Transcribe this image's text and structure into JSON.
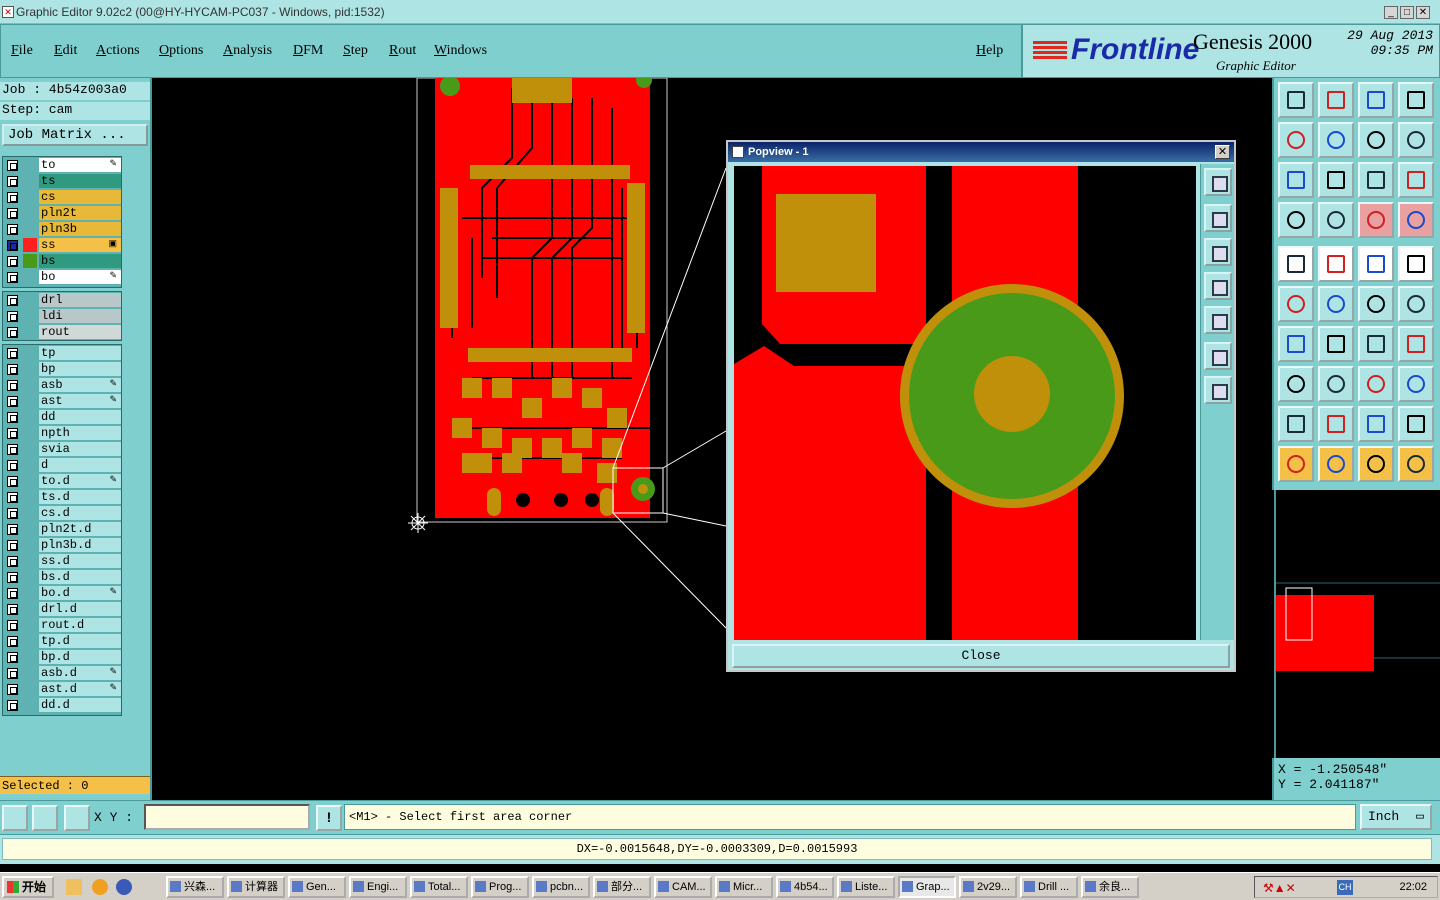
{
  "window": {
    "title": "Graphic Editor 9.02c2 (00@HY-HYCAM-PC037 - Windows, pid:1532)"
  },
  "menu": [
    "File",
    "Edit",
    "Actions",
    "Options",
    "Analysis",
    "DFM",
    "Step",
    "Rout",
    "Windows"
  ],
  "help": "Help",
  "brand": {
    "name": "Frontline",
    "product": "Genesis 2000",
    "subtitle": "Graphic Editor",
    "date": "29 Aug 2013",
    "time": "09:35 PM"
  },
  "job": {
    "job_line": "Job : 4b54z003a0",
    "step_line": "Step: cam",
    "matrix_button": "Job Matrix ..."
  },
  "layer_groups": [
    [
      {
        "name": "to",
        "color": "#ffffff",
        "edit": "✎"
      },
      {
        "name": "ts",
        "color": "#2f9a80",
        "edit": ""
      },
      {
        "name": "cs",
        "color": "#e8b838",
        "edit": ""
      },
      {
        "name": "pln2t",
        "color": "#e8b838",
        "edit": ""
      },
      {
        "name": "pln3b",
        "color": "#e8b838",
        "edit": ""
      },
      {
        "name": "ss",
        "color": "#f5c048",
        "edit": "▣",
        "active": true,
        "swatch": "#ff2020"
      },
      {
        "name": "bs",
        "color": "#2f9a80",
        "edit": "",
        "swatch": "#4a9a1a"
      },
      {
        "name": "bo",
        "color": "#ffffff",
        "edit": "✎"
      }
    ],
    [
      {
        "name": "drl",
        "color": "#b8c8c8",
        "edit": ""
      },
      {
        "name": "ldi",
        "color": "#b8c8c8",
        "edit": ""
      },
      {
        "name": "rout",
        "color": "#d0d8d8",
        "edit": ""
      }
    ],
    [
      {
        "name": "tp",
        "color": "#aee4e4",
        "edit": ""
      },
      {
        "name": "bp",
        "color": "#aee4e4",
        "edit": ""
      },
      {
        "name": "asb",
        "color": "#aee4e4",
        "edit": "✎"
      },
      {
        "name": "ast",
        "color": "#aee4e4",
        "edit": "✎"
      },
      {
        "name": "dd",
        "color": "#aee4e4",
        "edit": ""
      },
      {
        "name": "npth",
        "color": "#aee4e4",
        "edit": ""
      },
      {
        "name": "svia",
        "color": "#aee4e4",
        "edit": ""
      },
      {
        "name": "d",
        "color": "#aee4e4",
        "edit": ""
      },
      {
        "name": "to.d",
        "color": "#aee4e4",
        "edit": "✎"
      },
      {
        "name": "ts.d",
        "color": "#aee4e4",
        "edit": ""
      },
      {
        "name": "cs.d",
        "color": "#aee4e4",
        "edit": ""
      },
      {
        "name": "pln2t.d",
        "color": "#aee4e4",
        "edit": ""
      },
      {
        "name": "pln3b.d",
        "color": "#aee4e4",
        "edit": ""
      },
      {
        "name": "ss.d",
        "color": "#aee4e4",
        "edit": ""
      },
      {
        "name": "bs.d",
        "color": "#aee4e4",
        "edit": ""
      },
      {
        "name": "bo.d",
        "color": "#aee4e4",
        "edit": "✎"
      },
      {
        "name": "drl.d",
        "color": "#aee4e4",
        "edit": ""
      },
      {
        "name": "rout.d",
        "color": "#aee4e4",
        "edit": ""
      },
      {
        "name": "tp.d",
        "color": "#aee4e4",
        "edit": ""
      },
      {
        "name": "bp.d",
        "color": "#aee4e4",
        "edit": ""
      },
      {
        "name": "asb.d",
        "color": "#aee4e4",
        "edit": "✎"
      },
      {
        "name": "ast.d",
        "color": "#aee4e4",
        "edit": "✎"
      },
      {
        "name": "dd.d",
        "color": "#aee4e4",
        "edit": ""
      }
    ]
  ],
  "selected": "Selected : 0",
  "popview": {
    "title": "Popview - 1",
    "close_label": "Close"
  },
  "coords": {
    "x": "X = -1.250548\"",
    "y": "Y = 2.041187\""
  },
  "bottom": {
    "xy_label": "X Y :",
    "xy_value": "",
    "prompt": "<M1> - Select first area corner",
    "units": "Inch",
    "status": "DX=-0.0015648,DY=-0.0003309,D=0.0015993"
  },
  "taskbar": {
    "start": "开始",
    "tasks": [
      "兴森...",
      "计算器",
      "Gen...",
      "Engi...",
      "Total...",
      "Prog...",
      "pcbn...",
      "部分...",
      "CAM...",
      "Micr...",
      "4b54...",
      "Liste...",
      "Grap...",
      "2v29...",
      "Drill ...",
      "余良..."
    ],
    "active_task": 12,
    "tray_lang": "CH",
    "clock": "22:02"
  },
  "colors": {
    "panel": "#7fcfcf",
    "light": "#aee4e4",
    "copper": "#ff0000",
    "pad": "#c0900a",
    "via": "#4a9a1a"
  }
}
